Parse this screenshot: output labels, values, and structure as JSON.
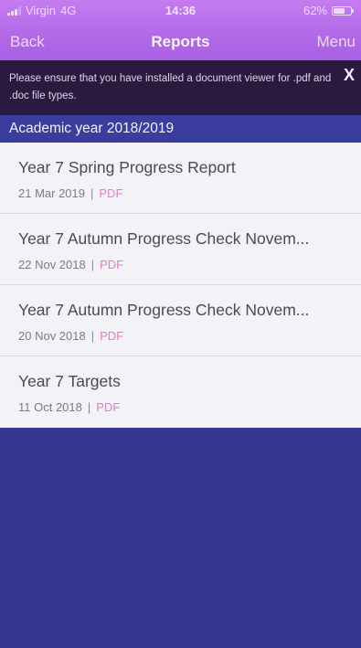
{
  "status_bar": {
    "carrier": "Virgin",
    "network": "4G",
    "time": "14:36",
    "battery": "62%"
  },
  "nav": {
    "back_label": "Back",
    "title": "Reports",
    "menu_label": "Menu"
  },
  "notice": {
    "text": "Please ensure that you have installed a document viewer for .pdf and .doc file types.",
    "close_label": "X"
  },
  "section": {
    "title": "Academic year 2018/2019"
  },
  "reports": [
    {
      "title": "Year 7 Spring Progress Report",
      "date": "21 Mar 2019",
      "separator": "|",
      "type": "PDF"
    },
    {
      "title": "Year 7 Autumn Progress Check Novem...",
      "date": "22 Nov 2018",
      "separator": "|",
      "type": "PDF"
    },
    {
      "title": "Year 7 Autumn Progress Check Novem...",
      "date": "20 Nov 2018",
      "separator": "|",
      "type": "PDF"
    },
    {
      "title": "Year 7 Targets",
      "date": "11 Oct 2018",
      "separator": "|",
      "type": "PDF"
    }
  ],
  "colors": {
    "header_accent": "#b36ae8",
    "notice_bg": "#2a1a3f",
    "section_bg": "#3a3c9e",
    "page_bg": "#34358c",
    "file_type": "#e27bc7"
  }
}
